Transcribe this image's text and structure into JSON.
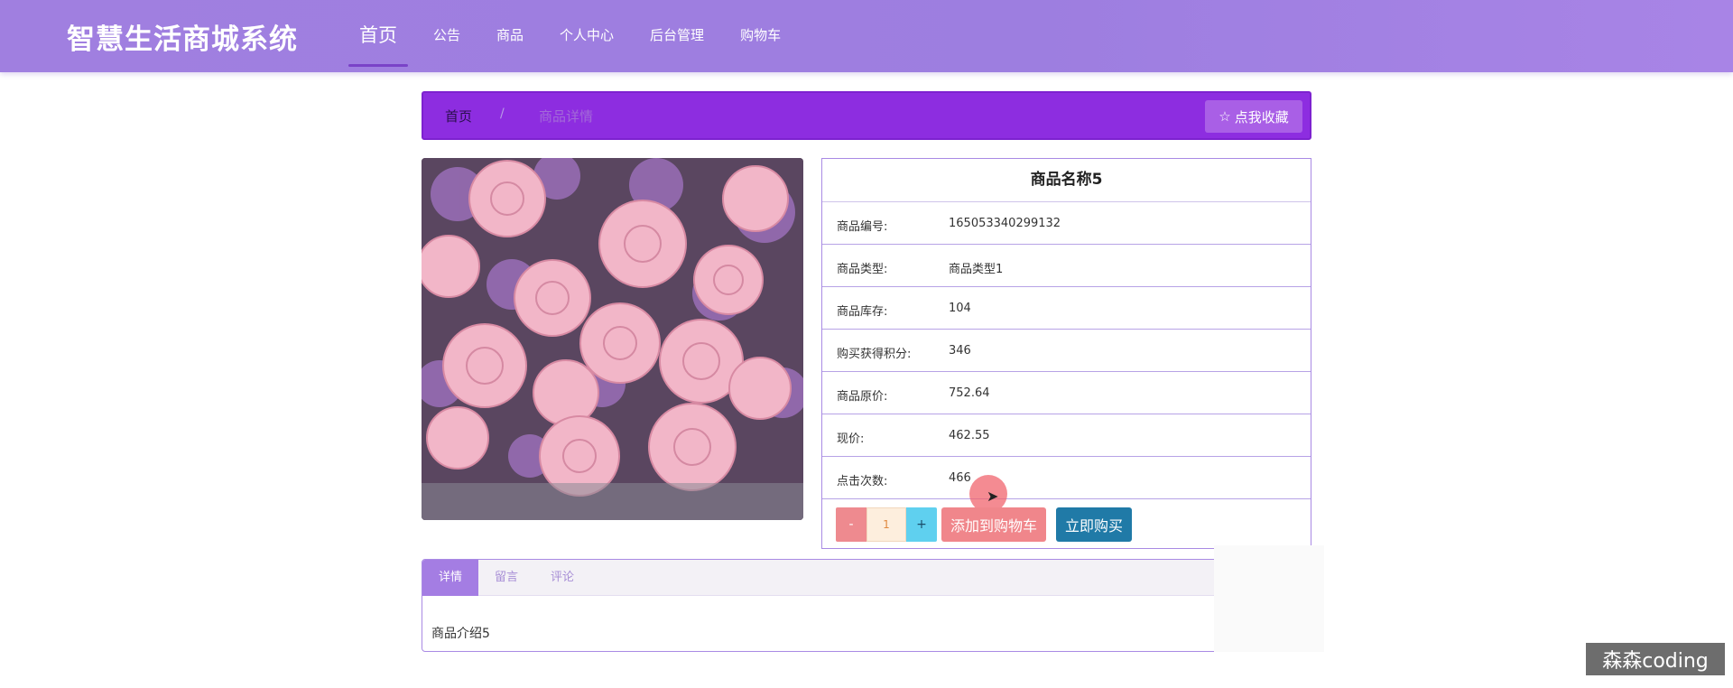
{
  "brand": "智慧生活商城系统",
  "nav": [
    {
      "label": "首页"
    },
    {
      "label": "公告"
    },
    {
      "label": "商品"
    },
    {
      "label": "个人中心"
    },
    {
      "label": "后台管理"
    },
    {
      "label": "购物车"
    }
  ],
  "breadcrumb": {
    "home": "首页",
    "separator": "/",
    "current": "商品详情"
  },
  "favorite_button": "点我收藏",
  "product": {
    "title": "商品名称5",
    "rows": [
      {
        "key": "商品编号:",
        "value": "165053340299132"
      },
      {
        "key": "商品类型:",
        "value": "商品类型1"
      },
      {
        "key": "商品库存:",
        "value": "104"
      },
      {
        "key": "购买获得积分:",
        "value": "346"
      },
      {
        "key": "商品原价:",
        "value": "752.64"
      },
      {
        "key": "现价:",
        "value": "462.55"
      },
      {
        "key": "点击次数:",
        "value": "466"
      }
    ],
    "quantity": "1",
    "minus": "-",
    "plus": "+",
    "add_to_cart": "添加到购物车",
    "buy_now": "立即购买"
  },
  "tabs": [
    {
      "label": "详情"
    },
    {
      "label": "留言"
    },
    {
      "label": "评论"
    }
  ],
  "detail_text": "商品介绍5",
  "watermark": "森森coding",
  "colors": {
    "nav_bg": "#9d7ee0",
    "crumb_bg": "#8d2de0",
    "cart_btn": "#f0868b",
    "buy_btn": "#207aa7",
    "tab_active": "#a47de3"
  }
}
